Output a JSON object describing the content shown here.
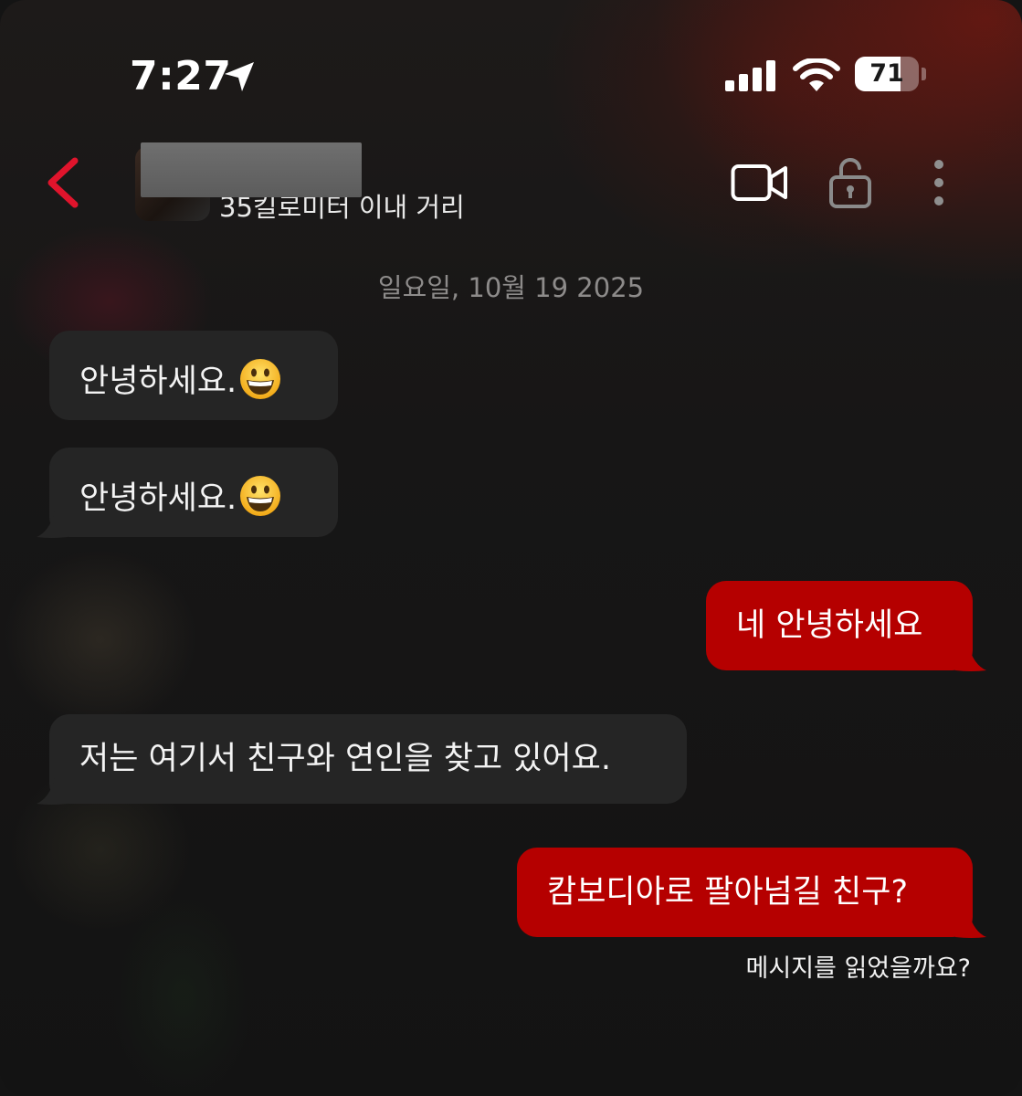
{
  "status_bar": {
    "time": "7:27",
    "battery": "71",
    "battery_level": 0.71
  },
  "header": {
    "contact_status": "35킬로미터 이내 거리"
  },
  "chat": {
    "date": "일요일, 10월 19 2025",
    "messages": [
      {
        "direction": "incoming",
        "text": "안녕하세요.",
        "emoji": "grinning-face-emoji"
      },
      {
        "direction": "incoming",
        "text": "안녕하세요.",
        "emoji": "grinning-face-emoji"
      },
      {
        "direction": "outgoing",
        "text": "네 안녕하세요"
      },
      {
        "direction": "incoming",
        "text": "저는 여기서 친구와 연인을 찾고 있어요."
      },
      {
        "direction": "outgoing",
        "text": "캄보디아로 팔아넘길 친구?"
      }
    ],
    "read_receipt": "메시지를 읽었을까요?"
  },
  "colors": {
    "accent": "#b50000",
    "back_arrow": "#e0142c",
    "incoming_bubble": "#252525"
  }
}
